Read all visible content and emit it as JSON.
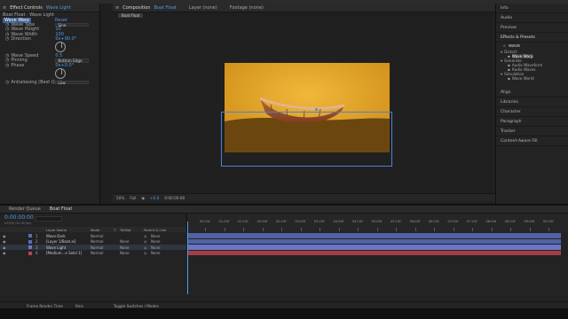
{
  "effect_controls": {
    "tab_label": "Effect Controls",
    "tab_layer": "Wave Light",
    "breadcrumb": "Boat Float · Wave Light",
    "effect_name": "Wave Warp",
    "reset_label": "Reset",
    "properties": [
      {
        "label": "Wave Type",
        "value": "Sine",
        "kind": "dropdown"
      },
      {
        "label": "Wave Height",
        "value": "10",
        "kind": "number"
      },
      {
        "label": "Wave Width",
        "value": "100",
        "kind": "number"
      },
      {
        "label": "Direction",
        "value": "0x+90.0°",
        "kind": "angle"
      },
      {
        "label": "Wave Speed",
        "value": "0.5",
        "kind": "number"
      },
      {
        "label": "Pinning",
        "value": "Bottom Edge",
        "kind": "dropdown"
      },
      {
        "label": "Phase",
        "value": "0x+0.0°",
        "kind": "angle"
      },
      {
        "label": "Antialiasing (Best Qual",
        "value": "Low",
        "kind": "dropdown"
      }
    ]
  },
  "composition": {
    "tab_label": "Composition",
    "tab_comp": "Boat Float",
    "layer_tab": "Layer (none)",
    "footage_tab": "Footage (none)",
    "comp_pill": "Boat Float",
    "toolbar": {
      "zoom": "50%",
      "resolution": "Full",
      "exposure": "+0.0",
      "timecode": "0:00:00:00"
    }
  },
  "right_panel": {
    "items": [
      "Info",
      "Audio",
      "Preview"
    ],
    "effects_title": "Effects & Presets",
    "search_value": "wave",
    "tree": [
      {
        "label": "Distort",
        "depth": 0
      },
      {
        "label": "Wave Warp",
        "depth": 1,
        "selected": true
      },
      {
        "label": "Generate",
        "depth": 0
      },
      {
        "label": "Audio Waveform",
        "depth": 1
      },
      {
        "label": "Radio Waves",
        "depth": 1
      },
      {
        "label": "Simulation",
        "depth": 0
      },
      {
        "label": "Wave World",
        "depth": 1
      }
    ],
    "panels": [
      "Align",
      "Libraries",
      "Character",
      "Paragraph",
      "Tracker",
      "Content-Aware Fill"
    ]
  },
  "timeline": {
    "tabs": [
      "Render Queue",
      "Boat Float"
    ],
    "timecode": "0:00:00:00",
    "timecode_sub": "00000 (30.00 fps)",
    "search_placeholder": "",
    "headers": {
      "layer_name": "Layer Name",
      "mode": "Mode",
      "trkmat": "T",
      "trkmat2": "TrkMat",
      "parent": "Parent & Link"
    },
    "layers": [
      {
        "index": "1",
        "name": "Wave Dark",
        "mode": "Normal",
        "trkmat": "",
        "parent": "None",
        "color": "#5a6db8"
      },
      {
        "index": "2",
        "name": "[Layer 1/Boat.ai]",
        "mode": "Normal",
        "trkmat": "None",
        "parent": "None",
        "color": "#5a6db8"
      },
      {
        "index": "3",
        "name": "Wave Light",
        "mode": "Normal",
        "trkmat": "None",
        "parent": "None",
        "color": "#6b76c8"
      },
      {
        "index": "4",
        "name": "[Medium...e Solid 1]",
        "mode": "Normal",
        "trkmat": "None",
        "parent": "None",
        "color": "#b8434f"
      }
    ],
    "ruler_ticks": [
      "00:15f",
      "01:00f",
      "01:15f",
      "02:00f",
      "02:15f",
      "03:00f",
      "03:15f",
      "04:00f",
      "04:15f",
      "05:00f",
      "05:15f",
      "06:00f",
      "06:15f",
      "07:00f",
      "07:15f",
      "08:00f",
      "08:15f",
      "09:00f",
      "09:15f"
    ],
    "footer": {
      "render_time": "Frame Render Time",
      "render_value": "0ms",
      "toggle": "Toggle Switches / Modes"
    }
  },
  "colors": {
    "accent": "#4f9be8",
    "canvas_top": "#e2a832",
    "canvas_water": "#6b470f",
    "layer_blue": "#5a6db8",
    "layer_red": "#b8434f"
  }
}
